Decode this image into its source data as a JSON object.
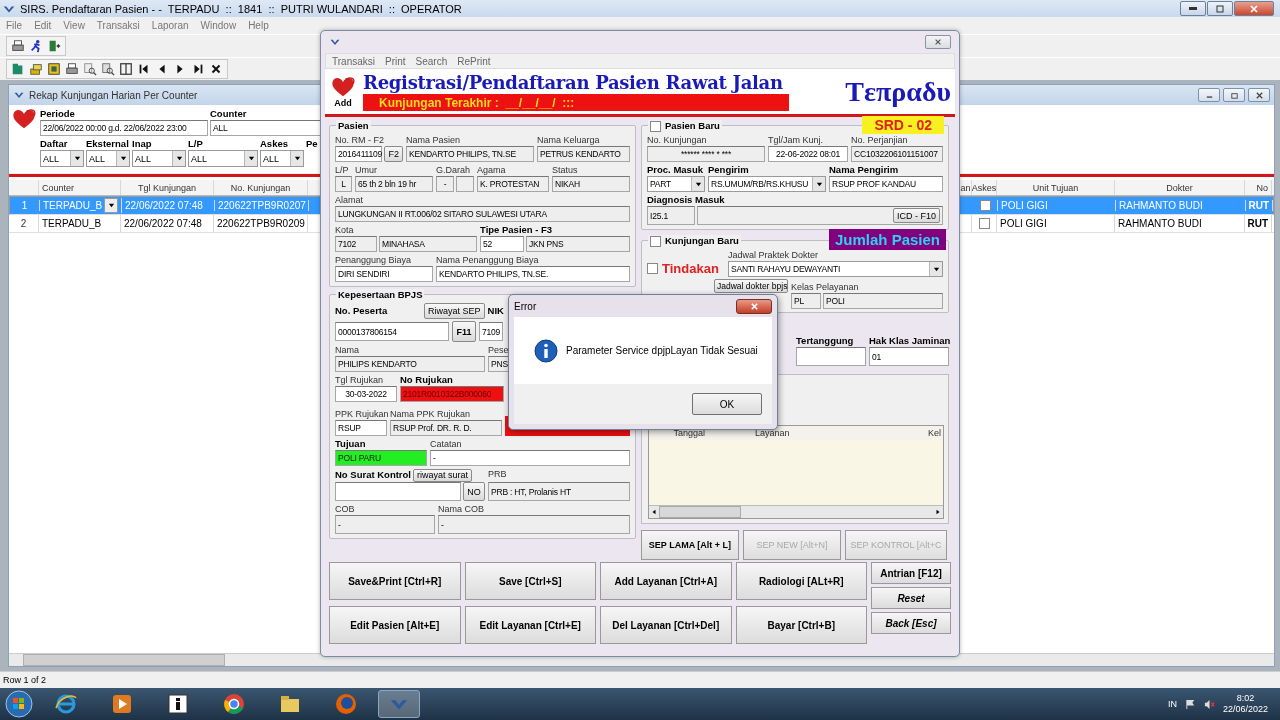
{
  "window": {
    "title": "SIRS. Pendaftaran Pasien - -  TERPADU  ::  1841  ::  PUTRI WULANDARI  ::  OPERATOR"
  },
  "menu": [
    "File",
    "Edit",
    "View",
    "Transaksi",
    "Laporan",
    "Window",
    "Help"
  ],
  "rekap": {
    "title": "Rekap Kunjungan Harian Per Counter",
    "periode_label": "Periode",
    "periode": "22/06/2022 00:00  g.d. 22/06/2022 23:00",
    "counter_label": "Counter",
    "counter": "ALL",
    "filters": [
      {
        "label": "Daftar",
        "value": "ALL"
      },
      {
        "label": "Eksternal",
        "value": "ALL"
      },
      {
        "label": "Inap",
        "value": "ALL"
      },
      {
        "label": "L/P",
        "value": "ALL"
      },
      {
        "label": "Askes",
        "value": "ALL"
      },
      {
        "label": "Pe"
      }
    ],
    "columns": [
      "Counter",
      "Tgl Kunjungan",
      "No. Kunjungan",
      "an",
      "Askes",
      "Unit Tujuan",
      "Dokter",
      "No"
    ],
    "rows": [
      {
        "num": "1",
        "counter": "TERPADU_B",
        "tgl": "22/06/2022 07:48",
        "no": "220622TPB9R0207",
        "askes": false,
        "unit": "POLI GIGI",
        "dokter": "RAHMANTO BUDI",
        "no_col": "RUT",
        "selected": true
      },
      {
        "num": "2",
        "counter": "TERPADU_B",
        "tgl": "22/06/2022 07:48",
        "no": "220622TPB9R0209",
        "askes": false,
        "unit": "POLI GIGI",
        "dokter": "RAHMANTO BUDI",
        "no_col": "RUT",
        "selected": false
      }
    ]
  },
  "status_bar": "Row 1 of 2",
  "form": {
    "add_label": "Add",
    "menu": [
      "Transaksi",
      "Print",
      "Search",
      "RePrint"
    ],
    "heading": "Registrasi/Pendaftaran Pasien Rawat Jalan",
    "logo": "Tεπραδυ",
    "last_visit": "Kunjungan Terakhir :  __/__/__/  :::",
    "pasien": {
      "legend": "Pasien",
      "no_rm_label": "No. RM - F2",
      "no_rm": "2016411109",
      "f2_button": "F2",
      "nama_label": "Nama Pasien",
      "nama": "KENDARTO PHILIPS, TN.SE",
      "keluarga_label": "Nama Keluarga",
      "keluarga": "PETRUS KENDARTO",
      "lp_label": "L/P",
      "lp": "L",
      "umur_label": "Umur",
      "umur": "65 th 2 bln 19 hr",
      "darah_label": "G.Darah",
      "darah": "-",
      "agama_label": "Agama",
      "agama": "K. PROTESTAN",
      "status_label": "Status",
      "status": "NIKAH",
      "alamat_label": "Alamat",
      "alamat": "LUNGKUNGAN II RT.006/02 SITARO SULAWESI UTARA",
      "kota_label": "Kota",
      "kota_kode": "7102",
      "kota": "MINAHASA",
      "tipe_label": "Tipe Pasien - F3",
      "tipe_kode": "52",
      "tipe": "JKN PNS",
      "penanggung_label": "Penanggung Biaya",
      "penanggung": "DIRI SENDIRI",
      "nama_penanggung_label": "Nama Penanggung Biaya",
      "nama_penanggung": "KENDARTO PHILIPS, TN.SE."
    },
    "bpjs": {
      "legend": "Kepesertaan BPJS",
      "no_peserta_label": "No. Peserta",
      "riwayat_sep_button": "Riwayat SEP",
      "nik_label": "NIK",
      "no_peserta": "0000137806154",
      "f11_button": "F11",
      "nik": "7109",
      "nama_label": "Nama",
      "peserta_label": "Pese",
      "nama": "PHILIPS KENDARTO",
      "peserta": "PNS",
      "tgl_rujukan_label": "Tgl Rujukan",
      "no_rujukan_label": "No Rujukan",
      "tgl_rujukan": "30-03-2022",
      "no_rujukan": "2101R0010322B000060",
      "ppk_label": "PPK Rujukan",
      "nama_ppk_label": "Nama PPK Rujukan",
      "ppk": "RSUP",
      "nama_ppk": "RSUP Prof. DR. R. D.",
      "tujuan_label": "Tujuan",
      "catatan_label": "Catatan",
      "tujuan": "POLI PARU",
      "catatan": "-",
      "surat_label": "No Surat Kontrol",
      "riwayat_surat_button": "riwayat surat",
      "no_button": "NO",
      "prb_label": "PRB",
      "prb": "PRB : HT, Prolanis HT",
      "cob_label": "COB",
      "nama_cob_label": "Nama COB",
      "cob": "-",
      "nama_cob": "-"
    },
    "kunjungan": {
      "legend": "Pasien Baru",
      "checked": false,
      "badge": "SRD - 02",
      "no_label": "No. Kunjungan",
      "no": "****** **** * ***",
      "tgl_label": "Tgl/Jam Kunj.",
      "tgl": "22-06-2022 08:01",
      "perjanjian_label": "No. Perjanjian",
      "perjanjian": "CC1032206101151007",
      "proc_label": "Proc. Masuk",
      "proc": "PART",
      "pengirim_label": "Pengirim",
      "pengirim": "RS.UMUM/RB/RS.KHUSU",
      "nama_pengirim_label": "Nama Pengirim",
      "nama_pengirim": "RSUP PROF KANDAU",
      "diagnosis_label": "Diagnosis Masuk",
      "diagnosis": "I25.1",
      "icd_button": "ICD - F10"
    },
    "kunjungan_baru": {
      "legend": "Kunjungan Baru",
      "checked": false,
      "badge": "Jumlah Pasien",
      "tindakan_label": "Tindakan",
      "tindakan_checked": false,
      "jadwal_label": "Jadwal Praktek Dokter",
      "jadwal": "SANTI RAHAYU DEWAYANTI",
      "jadwal_bpjs_button": "Jadwal dokter bpjs",
      "kelas_label": "Kelas Pelayanan",
      "kelas_kode": "PL",
      "kelas": "POLI",
      "tertanggung_label": "Tertanggung",
      "hak_label": "Hak Klas Jaminan",
      "hak": "01"
    },
    "layanan_columns": [
      "Tanggal",
      "Layanan",
      "Kel"
    ],
    "sep_buttons": [
      {
        "label": "SEP LAMA [Alt + L]",
        "disabled": false
      },
      {
        "label": "SEP NEW [Alt+N]",
        "disabled": true
      },
      {
        "label": "SEP KONTROL [Alt+C",
        "disabled": true
      }
    ],
    "action_buttons": [
      "Save&Print [Ctrl+R]",
      "Save [Ctrl+S]",
      "Add Layanan [Ctrl+A]",
      "Radiologi [ALt+R]",
      "Edit Pasien [Alt+E]",
      "Edit Layanan [Ctrl+E]",
      "Del Layanan [Ctrl+Del]",
      "Bayar [Ctrl+B]"
    ],
    "side_buttons": [
      {
        "label": "Antrian [F12]",
        "italic": false
      },
      {
        "label": "Reset",
        "italic": true
      },
      {
        "label": "Back [Esc]",
        "italic": true
      }
    ]
  },
  "error_dialog": {
    "title": "Error",
    "message": "Parameter Service dpjpLayan Tidak Sesuai",
    "button": "OK"
  },
  "taskbar": {
    "language": "IN",
    "time": "8:02",
    "date": "22/06/2022"
  }
}
